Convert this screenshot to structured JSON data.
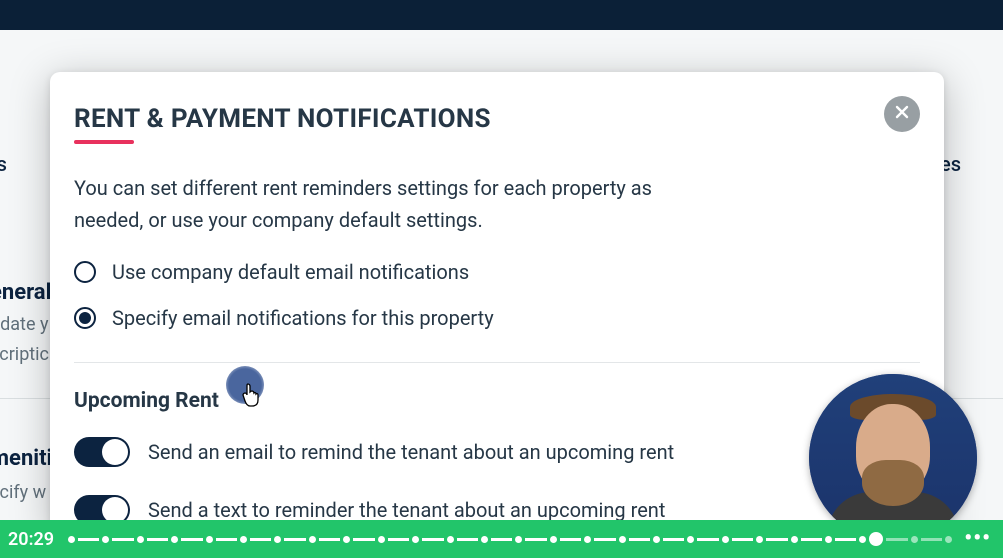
{
  "background": {
    "nav_right_fragment": "es",
    "nav_left_fragment": "ts",
    "section1_title": "eneral",
    "section1_desc_line1": "pdate y",
    "section1_desc_line2": "scriptic",
    "section2_title": "menitie",
    "section2_desc": "ecify w"
  },
  "modal": {
    "title": "RENT & PAYMENT NOTIFICATIONS",
    "description": "You can set different rent reminders settings for each property as needed, or use your company default settings.",
    "radios": [
      {
        "label": "Use company default email notifications",
        "selected": false
      },
      {
        "label": "Specify email notifications for this property",
        "selected": true
      }
    ],
    "subsection_title": "Upcoming Rent",
    "toggles": [
      {
        "label": "Send an email to remind the tenant about an upcoming rent",
        "on": true
      },
      {
        "label": "Send a text to reminder the tenant about an upcoming rent",
        "on": true
      }
    ]
  },
  "video": {
    "time": "20:29",
    "progress_segments": 26,
    "playhead_after_segment": 23
  }
}
